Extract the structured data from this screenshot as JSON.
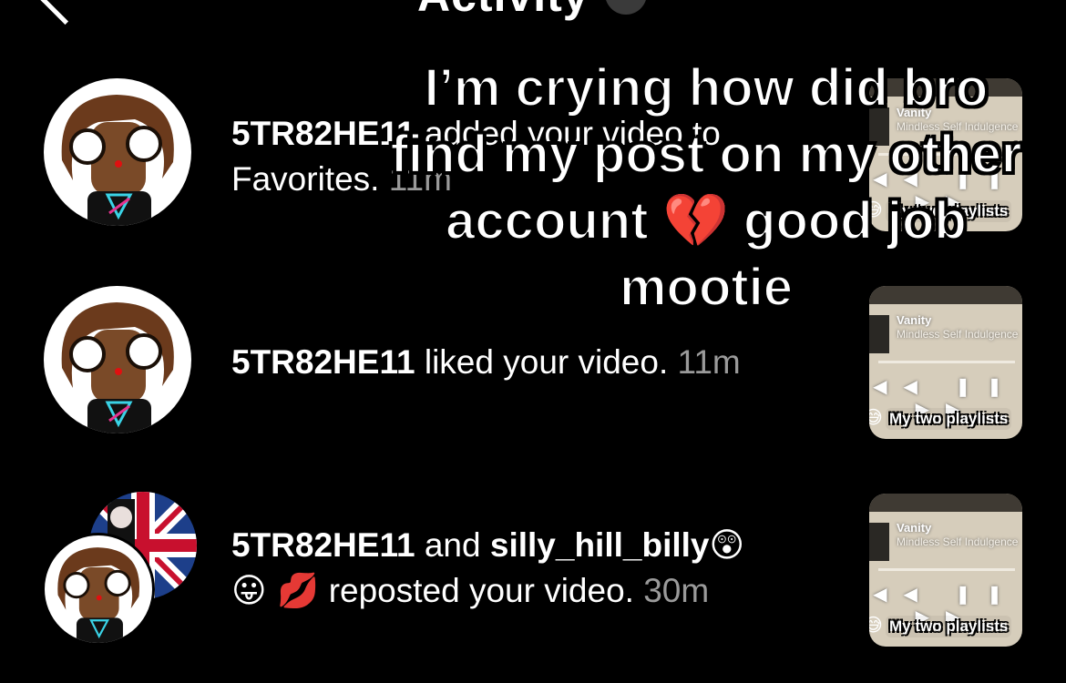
{
  "header": {
    "title": "Activity"
  },
  "caption": {
    "line1": "I’m crying how did bro",
    "line2": "find my post on my other",
    "line3_a": "account",
    "line3_emoji": "💔",
    "line3_b": "good job",
    "line4": "mootie"
  },
  "notifications": [
    {
      "user": "5TR82HE11",
      "action": "added your video to",
      "action_line2": "Favorites.",
      "time": "11m",
      "thumb_title": "Vanity",
      "thumb_sub": "Mindless Self Indulgence",
      "thumb_caption": "My two playlists"
    },
    {
      "user": "5TR82HE11",
      "action": "liked your video.",
      "time": "11m",
      "thumb_title": "Vanity",
      "thumb_sub": "Mindless Self Indulgence",
      "thumb_caption": "My two playlists"
    },
    {
      "user": "5TR82HE11",
      "conj": "and",
      "user2": "silly_hill_billy",
      "user2_emojis": "😲",
      "line2_emojis": "😛 💋",
      "action": "reposted your video.",
      "time": "30m",
      "thumb_title": "Vanity",
      "thumb_sub": "Mindless Self Indulgence",
      "thumb_caption": "My two playlists"
    }
  ],
  "icons": {
    "back": "back-chevron-icon",
    "pause": "pause-icon",
    "rewind": "rewind-icon",
    "forward": "forward-icon"
  }
}
